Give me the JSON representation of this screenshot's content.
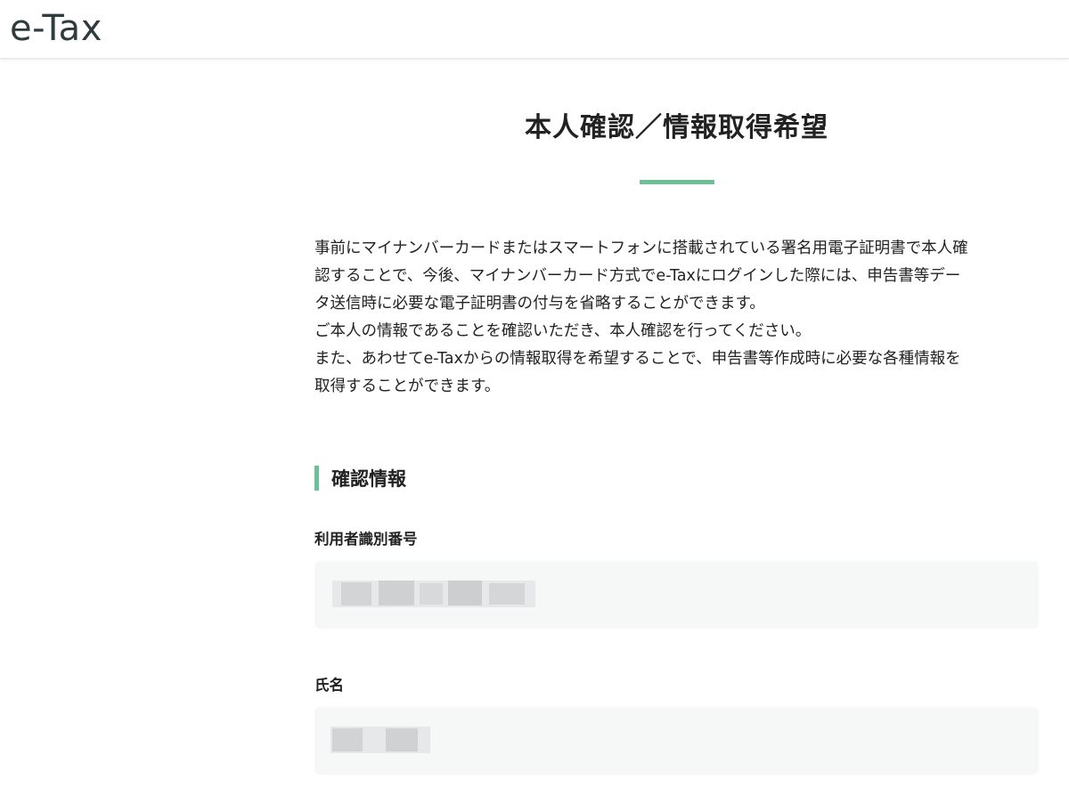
{
  "header": {
    "logo": "e-Tax"
  },
  "page": {
    "title": "本人確認／情報取得希望"
  },
  "intro": {
    "lines": [
      "事前にマイナンバーカードまたはスマートフォンに搭載されている署名用電子証明書で本人確",
      "認することで、今後、マイナンバーカード方式でe-Taxにログインした際には、申告書等デー",
      "タ送信時に必要な電子証明書の付与を省略することができます。",
      "ご本人の情報であることを確認いただき、本人確認を行ってください。",
      "また、あわせてe-Taxからの情報取得を希望することで、申告書等作成時に必要な各種情報を",
      "取得することができます。"
    ]
  },
  "section": {
    "title": "確認情報"
  },
  "fields": {
    "user_id": {
      "label": "利用者識別番号"
    },
    "name": {
      "label": "氏名"
    }
  },
  "colors": {
    "accent": "#6cc096",
    "field_bg": "#f6f7f7",
    "logo": "#2f3b3c"
  }
}
